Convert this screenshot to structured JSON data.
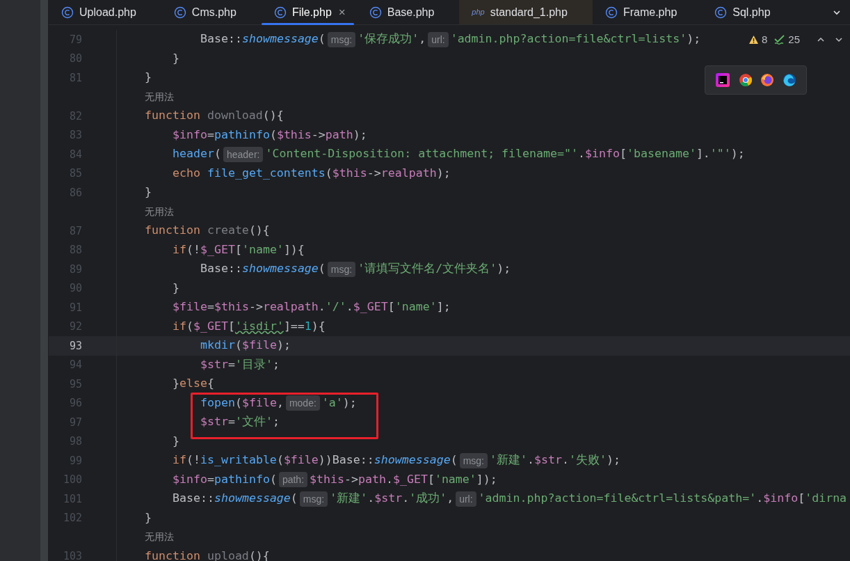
{
  "tabs": [
    {
      "label": "Upload.php",
      "kind": "class",
      "selected": false,
      "color": "#1e1f22"
    },
    {
      "label": "Cms.php",
      "kind": "class",
      "selected": false,
      "color": "#1e1f22"
    },
    {
      "label": "File.php",
      "kind": "class",
      "selected": true,
      "close": "×",
      "color": "#1e1f22"
    },
    {
      "label": "Base.php",
      "kind": "class",
      "selected": false,
      "color": "#1e1f22"
    },
    {
      "label": "standard_1.php",
      "kind": "php",
      "icon_text": "php",
      "selected": false,
      "color": "#2e2a25"
    },
    {
      "label": "Frame.php",
      "kind": "class",
      "selected": false,
      "color": "#1e1f22"
    },
    {
      "label": "Sql.php",
      "kind": "class",
      "selected": false,
      "color": "#1e1f22"
    }
  ],
  "inspections": {
    "warnings": "8",
    "weak_warnings": "25"
  },
  "lines": [
    {
      "kind": "inner",
      "number": "79",
      "current": false,
      "boxed": false,
      "tokens": [
        {
          "kind": "plain",
          "t": "Base::"
        },
        {
          "kind": "smeth",
          "t": "showmessage"
        },
        {
          "kind": "plain",
          "t": "("
        },
        {
          "kind": "hint",
          "t": "msg:"
        },
        {
          "kind": "str",
          "t": "'保存成功'"
        },
        {
          "kind": "plain",
          "t": ","
        },
        {
          "kind": "hint",
          "t": "url:"
        },
        {
          "kind": "str",
          "t": "'admin.php?action=file&ctrl=lists'"
        },
        {
          "kind": "plain",
          "t": ");"
        }
      ]
    },
    {
      "kind": "body",
      "number": "80",
      "current": false,
      "boxed": false,
      "tokens": [
        {
          "kind": "plain",
          "t": "}"
        }
      ]
    },
    {
      "kind": "member",
      "number": "81",
      "current": false,
      "boxed": false,
      "tokens": [
        {
          "kind": "plain",
          "t": "}"
        }
      ]
    },
    {
      "kind": "usage",
      "text": "无用法"
    },
    {
      "kind": "member",
      "number": "82",
      "current": false,
      "boxed": false,
      "tokens": [
        {
          "kind": "kw",
          "t": "function "
        },
        {
          "kind": "decl",
          "t": "download"
        },
        {
          "kind": "plain",
          "t": "(){"
        }
      ]
    },
    {
      "kind": "body",
      "number": "83",
      "current": false,
      "boxed": false,
      "tokens": [
        {
          "kind": "var",
          "t": "$info"
        },
        {
          "kind": "plain",
          "t": "="
        },
        {
          "kind": "fn",
          "t": "pathinfo"
        },
        {
          "kind": "plain",
          "t": "("
        },
        {
          "kind": "var",
          "t": "$this"
        },
        {
          "kind": "plain",
          "t": "->"
        },
        {
          "kind": "prop",
          "t": "path"
        },
        {
          "kind": "plain",
          "t": ");"
        }
      ]
    },
    {
      "kind": "body",
      "number": "84",
      "current": false,
      "boxed": false,
      "tokens": [
        {
          "kind": "fn",
          "t": "header"
        },
        {
          "kind": "plain",
          "t": "("
        },
        {
          "kind": "hint",
          "t": "header:"
        },
        {
          "kind": "str",
          "t": "'Content-Disposition: attachment; filename=\"'"
        },
        {
          "kind": "plain",
          "t": "."
        },
        {
          "kind": "var",
          "t": "$info"
        },
        {
          "kind": "plain",
          "t": "["
        },
        {
          "kind": "str",
          "t": "'basename'"
        },
        {
          "kind": "plain",
          "t": "]."
        },
        {
          "kind": "str",
          "t": "'\"'"
        },
        {
          "kind": "plain",
          "t": ");"
        }
      ]
    },
    {
      "kind": "body",
      "number": "85",
      "current": false,
      "boxed": false,
      "tokens": [
        {
          "kind": "kw",
          "t": "echo "
        },
        {
          "kind": "fn",
          "t": "file_get_contents"
        },
        {
          "kind": "plain",
          "t": "("
        },
        {
          "kind": "var",
          "t": "$this"
        },
        {
          "kind": "plain",
          "t": "->"
        },
        {
          "kind": "prop",
          "t": "realpath"
        },
        {
          "kind": "plain",
          "t": ");"
        }
      ]
    },
    {
      "kind": "member",
      "number": "86",
      "current": false,
      "boxed": false,
      "tokens": [
        {
          "kind": "plain",
          "t": "}"
        }
      ]
    },
    {
      "kind": "usage",
      "text": "无用法"
    },
    {
      "kind": "member",
      "number": "87",
      "current": false,
      "boxed": false,
      "tokens": [
        {
          "kind": "kw",
          "t": "function "
        },
        {
          "kind": "decl",
          "t": "create"
        },
        {
          "kind": "plain",
          "t": "(){"
        }
      ]
    },
    {
      "kind": "body",
      "number": "88",
      "current": false,
      "boxed": false,
      "tokens": [
        {
          "kind": "kw",
          "t": "if"
        },
        {
          "kind": "plain",
          "t": "(!"
        },
        {
          "kind": "var",
          "t": "$_GET"
        },
        {
          "kind": "plain",
          "t": "["
        },
        {
          "kind": "str",
          "t": "'name'"
        },
        {
          "kind": "plain",
          "t": "]){"
        }
      ]
    },
    {
      "kind": "inner",
      "number": "89",
      "current": false,
      "boxed": false,
      "tokens": [
        {
          "kind": "plain",
          "t": "Base::"
        },
        {
          "kind": "smeth",
          "t": "showmessage"
        },
        {
          "kind": "plain",
          "t": "("
        },
        {
          "kind": "hint",
          "t": "msg:"
        },
        {
          "kind": "str",
          "t": "'请填写文件名/文件夹名'"
        },
        {
          "kind": "plain",
          "t": ");"
        }
      ]
    },
    {
      "kind": "body",
      "number": "90",
      "current": false,
      "boxed": false,
      "tokens": [
        {
          "kind": "plain",
          "t": "}"
        }
      ]
    },
    {
      "kind": "body",
      "number": "91",
      "current": false,
      "boxed": false,
      "tokens": [
        {
          "kind": "var",
          "t": "$file"
        },
        {
          "kind": "plain",
          "t": "="
        },
        {
          "kind": "var",
          "t": "$this"
        },
        {
          "kind": "plain",
          "t": "->"
        },
        {
          "kind": "prop",
          "t": "realpath"
        },
        {
          "kind": "plain",
          "t": "."
        },
        {
          "kind": "str",
          "t": "'/'"
        },
        {
          "kind": "plain",
          "t": "."
        },
        {
          "kind": "var",
          "t": "$_GET"
        },
        {
          "kind": "plain",
          "t": "["
        },
        {
          "kind": "str",
          "t": "'name'"
        },
        {
          "kind": "plain",
          "t": "];"
        }
      ]
    },
    {
      "kind": "body",
      "number": "92",
      "current": false,
      "boxed": false,
      "tokens": [
        {
          "kind": "kw",
          "t": "if"
        },
        {
          "kind": "plain",
          "t": "("
        },
        {
          "kind": "var",
          "t": "$_GET"
        },
        {
          "kind": "plain",
          "t": "["
        },
        {
          "kind": "typo",
          "t": "'isdir'"
        },
        {
          "kind": "plain",
          "t": "]=="
        },
        {
          "kind": "num",
          "t": "1"
        },
        {
          "kind": "plain",
          "t": "){"
        }
      ]
    },
    {
      "kind": "inner",
      "number": "93",
      "current": true,
      "boxed": false,
      "tokens": [
        {
          "kind": "fn",
          "t": "mkdir"
        },
        {
          "kind": "plain",
          "t": "("
        },
        {
          "kind": "var",
          "t": "$file"
        },
        {
          "kind": "plain",
          "t": ");"
        }
      ]
    },
    {
      "kind": "inner",
      "number": "94",
      "current": false,
      "boxed": false,
      "tokens": [
        {
          "kind": "var",
          "t": "$str"
        },
        {
          "kind": "plain",
          "t": "="
        },
        {
          "kind": "str",
          "t": "'目录'"
        },
        {
          "kind": "plain",
          "t": ";"
        }
      ]
    },
    {
      "kind": "body",
      "number": "95",
      "current": false,
      "boxed": false,
      "tokens": [
        {
          "kind": "plain",
          "t": "}"
        },
        {
          "kind": "kw",
          "t": "else"
        },
        {
          "kind": "plain",
          "t": "{"
        }
      ]
    },
    {
      "kind": "inner",
      "number": "96",
      "current": false,
      "boxed": true,
      "tokens": [
        {
          "kind": "fn",
          "t": "fopen"
        },
        {
          "kind": "plain",
          "t": "("
        },
        {
          "kind": "var",
          "t": "$file"
        },
        {
          "kind": "plain",
          "t": ","
        },
        {
          "kind": "hint",
          "t": "mode:"
        },
        {
          "kind": "str",
          "t": "'a'"
        },
        {
          "kind": "plain",
          "t": ");"
        }
      ]
    },
    {
      "kind": "inner",
      "number": "97",
      "current": false,
      "boxed": true,
      "tokens": [
        {
          "kind": "var",
          "t": "$str"
        },
        {
          "kind": "plain",
          "t": "="
        },
        {
          "kind": "str",
          "t": "'文件'"
        },
        {
          "kind": "plain",
          "t": ";"
        }
      ]
    },
    {
      "kind": "body",
      "number": "98",
      "current": false,
      "boxed": false,
      "tokens": [
        {
          "kind": "plain",
          "t": "}"
        }
      ]
    },
    {
      "kind": "body",
      "number": "99",
      "current": false,
      "boxed": false,
      "tokens": [
        {
          "kind": "kw",
          "t": "if"
        },
        {
          "kind": "plain",
          "t": "(!"
        },
        {
          "kind": "fn",
          "t": "is_writable"
        },
        {
          "kind": "plain",
          "t": "("
        },
        {
          "kind": "var",
          "t": "$file"
        },
        {
          "kind": "plain",
          "t": "))Base::"
        },
        {
          "kind": "smeth",
          "t": "showmessage"
        },
        {
          "kind": "plain",
          "t": "("
        },
        {
          "kind": "hint",
          "t": "msg:"
        },
        {
          "kind": "str",
          "t": "'新建'"
        },
        {
          "kind": "plain",
          "t": "."
        },
        {
          "kind": "var",
          "t": "$str"
        },
        {
          "kind": "plain",
          "t": "."
        },
        {
          "kind": "str",
          "t": "'失败'"
        },
        {
          "kind": "plain",
          "t": ");"
        }
      ]
    },
    {
      "kind": "body",
      "number": "100",
      "current": false,
      "boxed": false,
      "tokens": [
        {
          "kind": "var",
          "t": "$info"
        },
        {
          "kind": "plain",
          "t": "="
        },
        {
          "kind": "fn",
          "t": "pathinfo"
        },
        {
          "kind": "plain",
          "t": "("
        },
        {
          "kind": "hint",
          "t": "path:"
        },
        {
          "kind": "var",
          "t": "$this"
        },
        {
          "kind": "plain",
          "t": "->"
        },
        {
          "kind": "prop",
          "t": "path"
        },
        {
          "kind": "plain",
          "t": "."
        },
        {
          "kind": "var",
          "t": "$_GET"
        },
        {
          "kind": "plain",
          "t": "["
        },
        {
          "kind": "str",
          "t": "'name'"
        },
        {
          "kind": "plain",
          "t": "]);"
        }
      ]
    },
    {
      "kind": "body",
      "number": "101",
      "current": false,
      "boxed": false,
      "tokens": [
        {
          "kind": "plain",
          "t": "Base::"
        },
        {
          "kind": "smeth",
          "t": "showmessage"
        },
        {
          "kind": "plain",
          "t": "("
        },
        {
          "kind": "hint",
          "t": "msg:"
        },
        {
          "kind": "str",
          "t": "'新建'"
        },
        {
          "kind": "plain",
          "t": "."
        },
        {
          "kind": "var",
          "t": "$str"
        },
        {
          "kind": "plain",
          "t": "."
        },
        {
          "kind": "str",
          "t": "'成功'"
        },
        {
          "kind": "plain",
          "t": ","
        },
        {
          "kind": "hint",
          "t": "url:"
        },
        {
          "kind": "str",
          "t": "'admin.php?action=file&ctrl=lists&path='"
        },
        {
          "kind": "plain",
          "t": "."
        },
        {
          "kind": "var",
          "t": "$info"
        },
        {
          "kind": "plain",
          "t": "["
        },
        {
          "kind": "str",
          "t": "'dirna"
        }
      ]
    },
    {
      "kind": "member",
      "number": "102",
      "current": false,
      "boxed": false,
      "tokens": [
        {
          "kind": "plain",
          "t": "}"
        }
      ]
    },
    {
      "kind": "usage",
      "text": "无用法"
    },
    {
      "kind": "member",
      "number": "103",
      "current": false,
      "boxed": false,
      "tokens": [
        {
          "kind": "kw",
          "t": "function "
        },
        {
          "kind": "decl",
          "t": "upload"
        },
        {
          "kind": "plain",
          "t": "(){"
        }
      ]
    }
  ]
}
